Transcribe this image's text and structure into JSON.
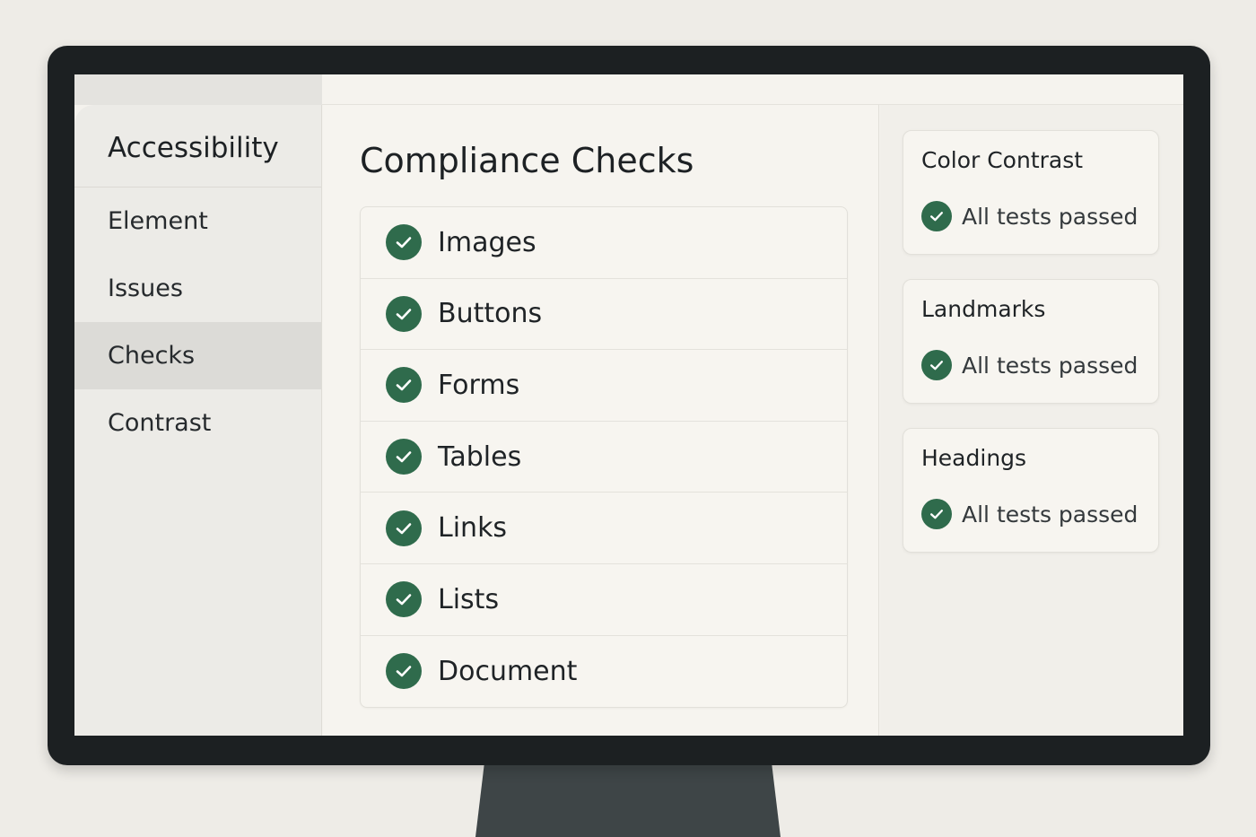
{
  "sidebar": {
    "title": "Accessibility",
    "items": [
      {
        "label": "Element",
        "active": false
      },
      {
        "label": "Issues",
        "active": false
      },
      {
        "label": "Checks",
        "active": true
      },
      {
        "label": "Contrast",
        "active": false
      }
    ]
  },
  "main": {
    "title": "Compliance Checks",
    "checks": [
      {
        "label": "Images",
        "icon": "check-circle-icon"
      },
      {
        "label": "Buttons",
        "icon": "check-circle-icon"
      },
      {
        "label": "Forms",
        "icon": "check-circle-icon"
      },
      {
        "label": "Tables",
        "icon": "check-circle-icon"
      },
      {
        "label": "Links",
        "icon": "check-circle-icon"
      },
      {
        "label": "Lists",
        "icon": "check-circle-icon"
      },
      {
        "label": "Document",
        "icon": "check-circle-icon"
      }
    ]
  },
  "summary": {
    "cards": [
      {
        "title": "Color Contrast",
        "status": "All tests passed"
      },
      {
        "title": "Landmarks",
        "status": "All tests passed"
      },
      {
        "title": "Headings",
        "status": "All tests passed"
      }
    ]
  },
  "colors": {
    "accent_green": "#2f6b4c",
    "bezel": "#1c2022",
    "background": "#eeece7"
  }
}
